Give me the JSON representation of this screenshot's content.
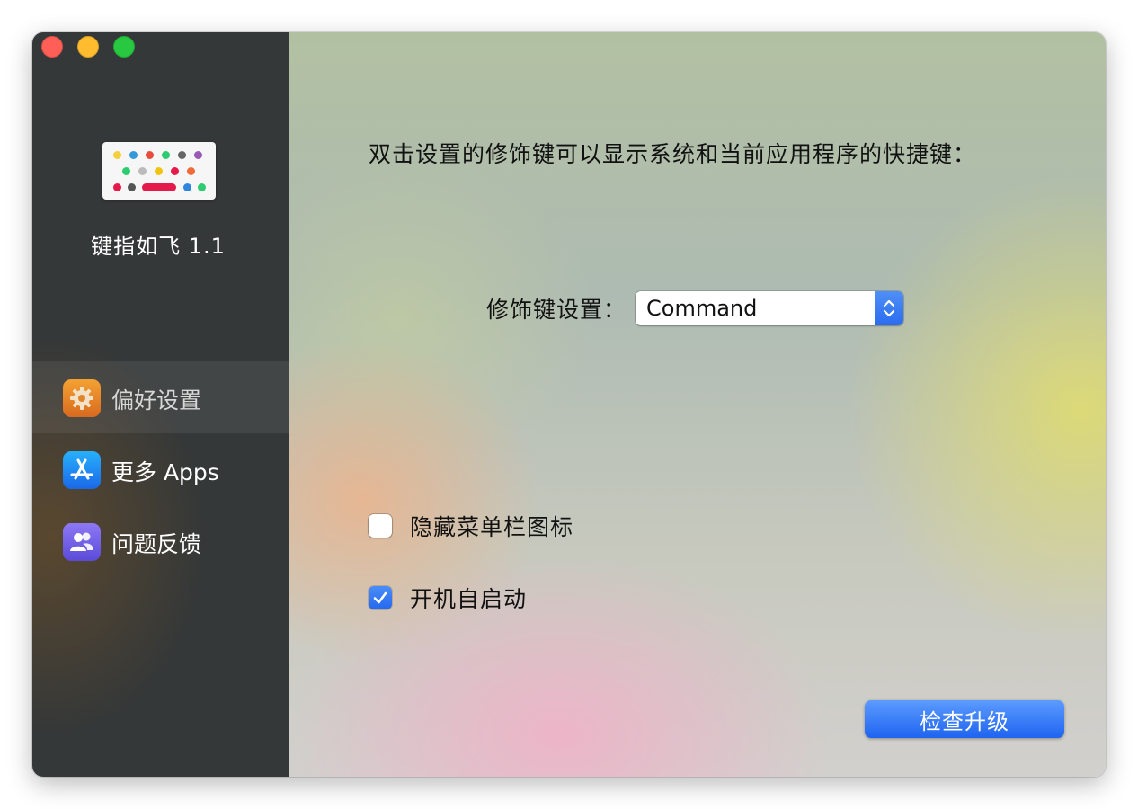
{
  "window": {
    "traffic_lights": [
      "close",
      "minimize",
      "maximize"
    ]
  },
  "sidebar": {
    "app_name": "键指如飞 1.1",
    "items": [
      {
        "label": "偏好设置",
        "icon": "gear-icon",
        "selected": true
      },
      {
        "label": "更多 Apps",
        "icon": "app-store-icon",
        "selected": false
      },
      {
        "label": "问题反馈",
        "icon": "people-icon",
        "selected": false
      }
    ]
  },
  "main": {
    "headline": "双击设置的修饰键可以显示系统和当前应用程序的快捷键：",
    "modifier_label": "修饰键设置：",
    "modifier_value": "Command",
    "options": [
      {
        "label": "隐藏菜单栏图标",
        "checked": false
      },
      {
        "label": "开机自启动",
        "checked": true
      }
    ],
    "upgrade_button": "检查升级"
  },
  "colors": {
    "sidebar_bg": "#353838",
    "accent": "#2a6cf0",
    "close": "#ff5f57",
    "minimize": "#febc2e",
    "maximize": "#28c840"
  }
}
